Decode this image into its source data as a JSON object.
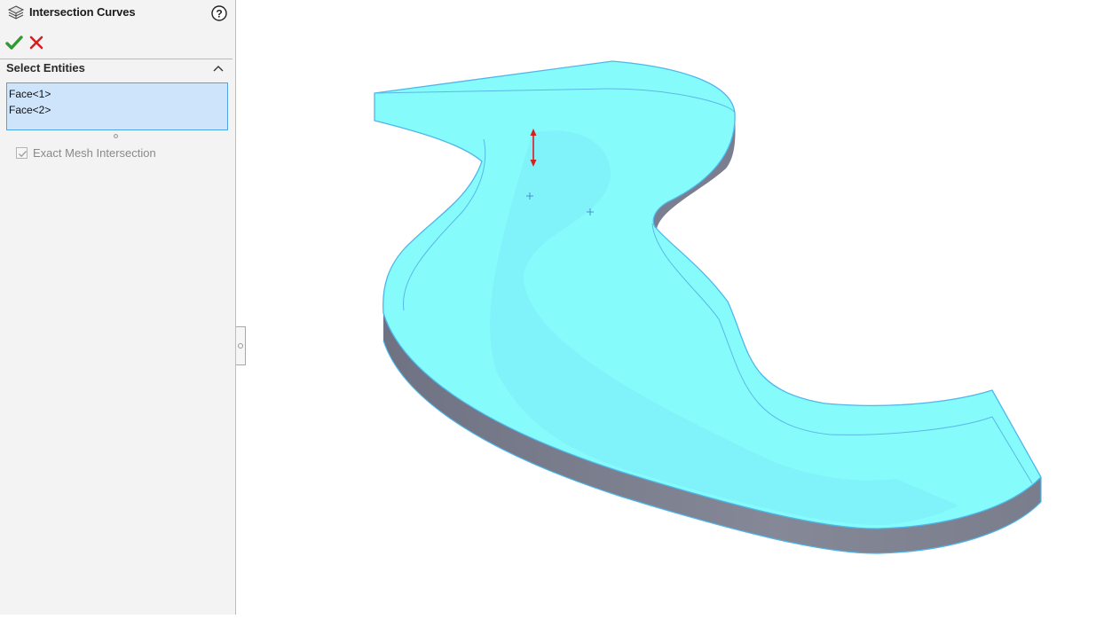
{
  "panel": {
    "title": "Intersection Curves",
    "icons": {
      "feature": "intersection-curves-icon",
      "help": "help-icon",
      "ok": "check-icon",
      "cancel": "close-icon",
      "collapse": "chevron-up-icon"
    },
    "colors": {
      "ok": "#2e9b2e",
      "cancel": "#d42020",
      "selection_box": "#cde4fb",
      "selection_border": "#4da3ea"
    },
    "select_entities": {
      "title": "Select Entities",
      "items": [
        "Face<1>",
        "Face<2>"
      ]
    },
    "exact_mesh": {
      "label": "Exact Mesh Intersection",
      "checked": true,
      "enabled": false
    }
  },
  "viewport": {
    "colors": {
      "face": "#86fbfc",
      "face_shade": "#7cf0f8",
      "side_wall": "#7f8291",
      "edge_highlight": "#4fb6ea",
      "arrow": "#d81e1e",
      "origin_mark": "#4a8fd0"
    }
  }
}
